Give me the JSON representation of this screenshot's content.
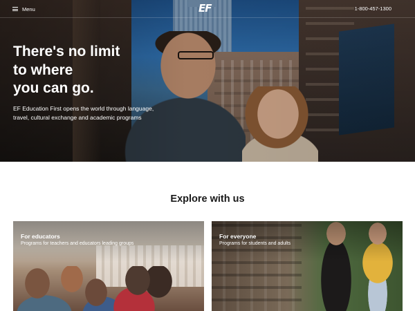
{
  "header": {
    "menu_label": "Menu",
    "logo_text": "EF",
    "phone": "1-800-457-1300"
  },
  "hero": {
    "title_lines": [
      "There's no limit",
      "to where",
      "you can go."
    ],
    "subtitle": "EF Education First opens the world through language, travel, cultural exchange and academic programs"
  },
  "explore": {
    "title": "Explore with us",
    "cards": [
      {
        "title": "For educators",
        "subtitle": "Programs for teachers and educators leading groups"
      },
      {
        "title": "For everyone",
        "subtitle": "Programs for students and adults"
      }
    ]
  },
  "colors": {
    "text_dark": "#191919",
    "hero_text": "#ffffff",
    "background": "#ffffff"
  }
}
